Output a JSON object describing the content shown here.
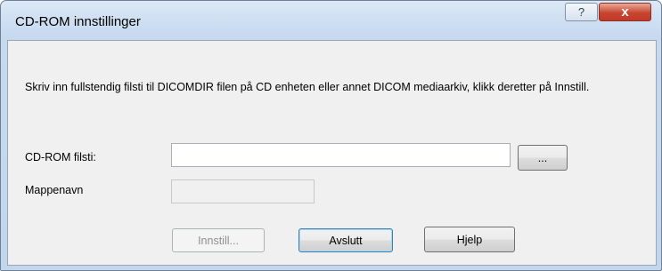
{
  "window": {
    "title": "CD-ROM innstillinger",
    "help_glyph": "?",
    "close_glyph": "x"
  },
  "instructions": "Skriv inn fullstendig filsti til DICOMDIR filen på CD enheten eller annet DICOM mediaarkiv, klikk deretter på Innstill.",
  "form": {
    "cdrom_label": "CD-ROM filsti:",
    "cdrom_value": "",
    "browse_label": "...",
    "folder_label": "Mappenavn",
    "folder_value": ""
  },
  "buttons": {
    "apply": "Innstill...",
    "exit": "Avslutt",
    "help": "Hjelp"
  }
}
